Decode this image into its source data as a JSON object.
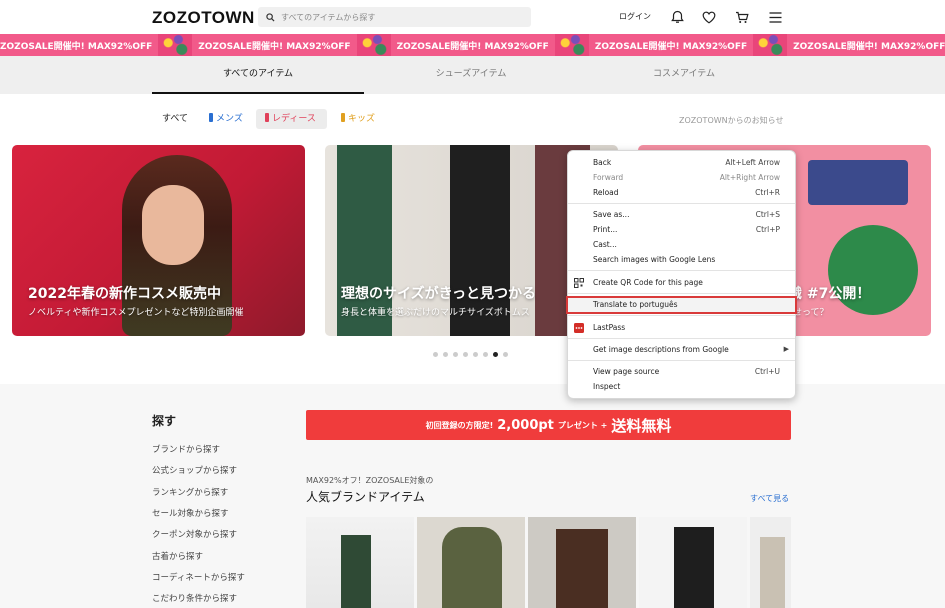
{
  "header": {
    "logo": "ZOZOTOWN",
    "search_placeholder": "すべてのアイテムから探す",
    "login": "ログイン",
    "icons": [
      "bell-icon",
      "heart-icon",
      "cart-icon",
      "menu-icon"
    ]
  },
  "banner": {
    "text": "ZOZOSALE開催中! MAX92%OFF",
    "color": "#f25a8a"
  },
  "tabs": [
    {
      "label": "すべてのアイテム",
      "active": true
    },
    {
      "label": "シューズアイテム",
      "active": false
    },
    {
      "label": "コスメアイテム",
      "active": false
    }
  ],
  "filters": [
    {
      "label": "すべて",
      "color": "#222"
    },
    {
      "label": "メンズ",
      "color": "#2a6fd1"
    },
    {
      "label": "レディース",
      "color": "#e0415a"
    },
    {
      "label": "キッズ",
      "color": "#e0a020"
    }
  ],
  "notice": "ZOZOTOWNからのお知らせ",
  "carousel": [
    {
      "title": "2022年春の新作コスメ販売中",
      "subtitle": "ノベルティや新作コスメプレゼントなど特別企画開催"
    },
    {
      "title": "理想のサイズがきっと見つかる",
      "subtitle": "身長と体重を選ぶだけのマルチサイズボトムス"
    },
    {
      "title": "識 #7公開！",
      "subtitle": "せって？"
    }
  ],
  "carousel_dots": {
    "count": 8,
    "active": 6
  },
  "sidebar": {
    "title": "探す",
    "links": [
      "ブランドから探す",
      "公式ショップから探す",
      "ランキングから探す",
      "セール対象から探す",
      "クーポン対象から探す",
      "古着から探す",
      "コーディネートから探す",
      "こだわり条件から探す"
    ]
  },
  "promo": {
    "part1": "初回登録の方限定!",
    "part2": "2,000pt",
    "part3": "プレゼント + ",
    "part4": "送料無料"
  },
  "section": {
    "eyebrow": "MAX92%オフ！ZOZOSALE対象の",
    "title": "人気ブランドアイテム",
    "see_all": "すべて見る"
  },
  "context_menu": {
    "items": [
      {
        "label": "Back",
        "shortcut": "Alt+Left Arrow",
        "disabled": false
      },
      {
        "label": "Forward",
        "shortcut": "Alt+Right Arrow",
        "disabled": true
      },
      {
        "label": "Reload",
        "shortcut": "Ctrl+R",
        "disabled": false
      },
      {
        "label": "Save as...",
        "shortcut": "Ctrl+S",
        "disabled": false
      },
      {
        "label": "Print...",
        "shortcut": "Ctrl+P",
        "disabled": false
      },
      {
        "label": "Cast...",
        "shortcut": "",
        "disabled": false
      },
      {
        "label": "Search images with Google Lens",
        "shortcut": "",
        "disabled": false
      },
      {
        "label": "Create QR Code for this page",
        "shortcut": "",
        "disabled": false
      },
      {
        "label": "Translate to português",
        "shortcut": "",
        "disabled": false,
        "highlighted": true
      },
      {
        "label": "LastPass",
        "shortcut": "",
        "disabled": false
      },
      {
        "label": "Get image descriptions from Google",
        "shortcut": "",
        "disabled": false,
        "submenu": true
      },
      {
        "label": "View page source",
        "shortcut": "Ctrl+U",
        "disabled": false
      },
      {
        "label": "Inspect",
        "shortcut": "",
        "disabled": false
      }
    ]
  }
}
